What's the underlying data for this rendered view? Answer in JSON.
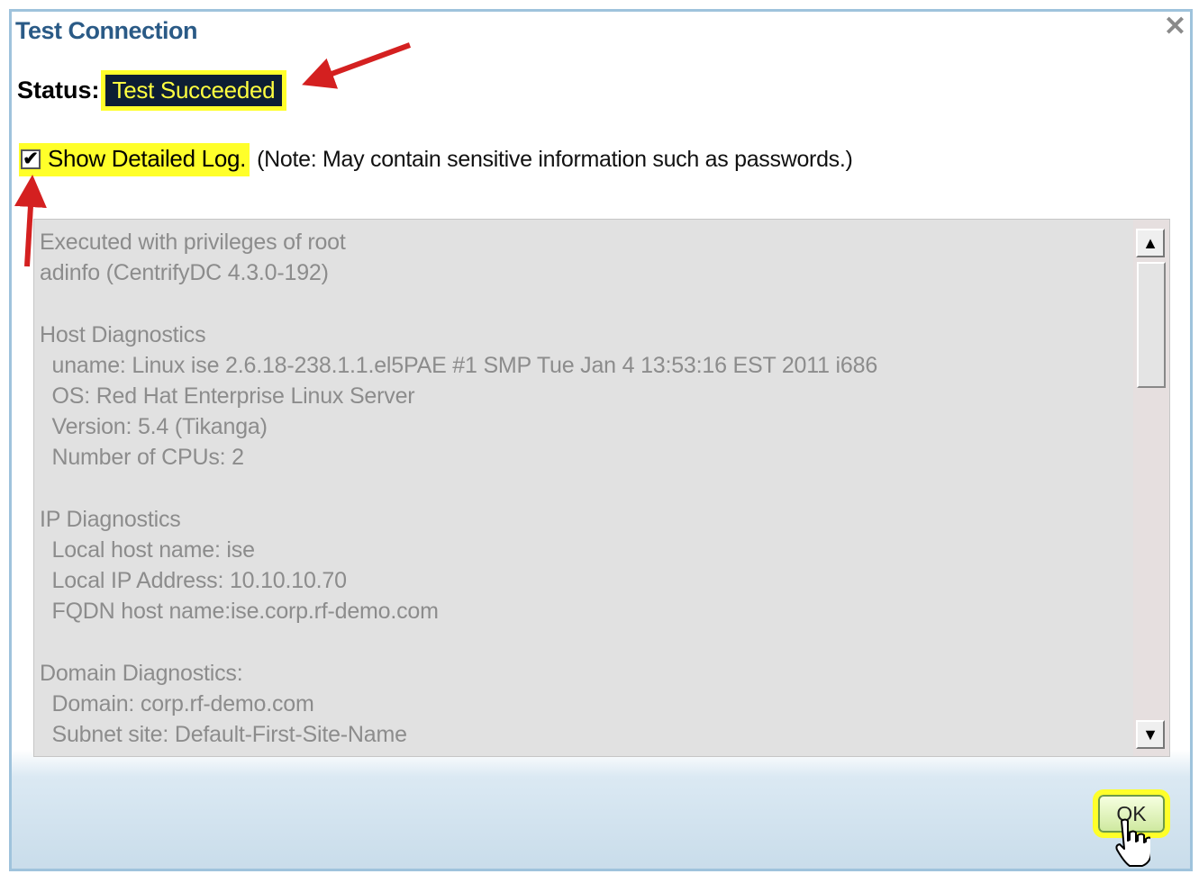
{
  "dialog": {
    "title": "Test Connection",
    "close_glyph": "✕",
    "status_label": "Status:",
    "status_value": "Test Succeeded",
    "show_log_checked": true,
    "show_log_label": "Show Detailed Log.",
    "note": "(Note: May contain sensitive information such as passwords.)",
    "log_lines": [
      "Executed with privileges of root",
      "adinfo (CentrifyDC 4.3.0-192)",
      "",
      "Host Diagnostics",
      "  uname: Linux ise 2.6.18-238.1.1.el5PAE #1 SMP Tue Jan 4 13:53:16 EST 2011 i686",
      "  OS: Red Hat Enterprise Linux Server",
      "  Version: 5.4 (Tikanga)",
      "  Number of CPUs: 2",
      "",
      "IP Diagnostics",
      "  Local host name: ise",
      "  Local IP Address: 10.10.10.70",
      "  FQDN host name:ise.corp.rf-demo.com",
      "",
      "Domain Diagnostics:",
      "  Domain: corp.rf-demo.com",
      "  Subnet site: Default-First-Site-Name"
    ],
    "scroll_up_glyph": "▲",
    "scroll_down_glyph": "▼",
    "ok_label": "OK"
  },
  "colors": {
    "title": "#2a5a86",
    "highlight": "#ffff2a",
    "status_bg": "#0d1e34",
    "annotation_arrow": "#d42020"
  },
  "icons": [
    "close-icon",
    "checkbox-checked-icon",
    "scroll-up-arrow-icon",
    "scroll-down-arrow-icon",
    "hand-cursor-icon",
    "annotation-arrow-icon"
  ]
}
